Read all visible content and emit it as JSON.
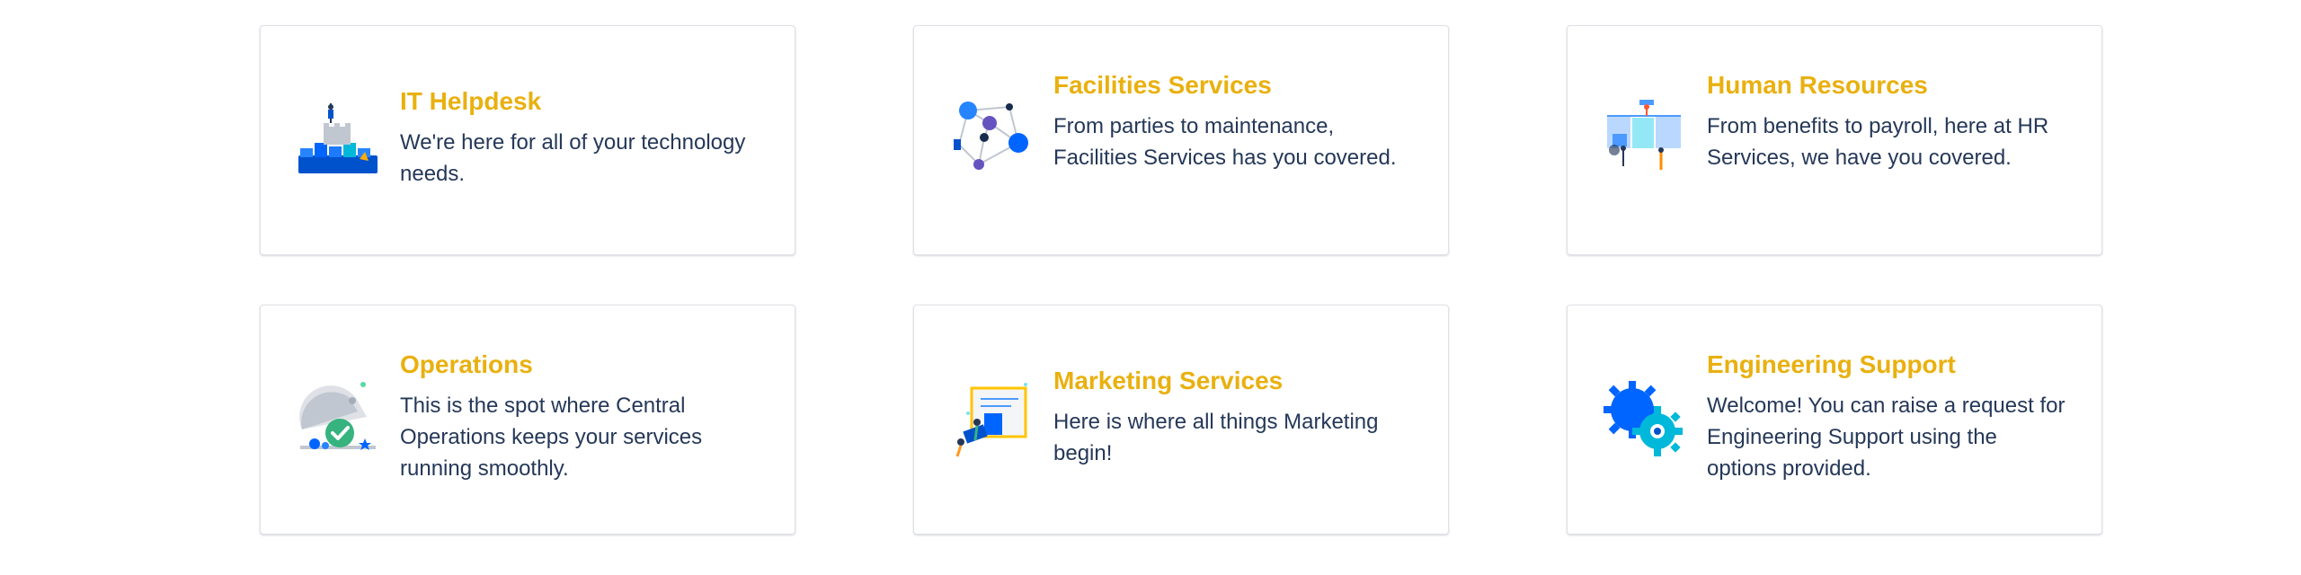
{
  "portals": [
    {
      "title": "IT Helpdesk",
      "description": "We're here for all of your technology needs.",
      "icon": "it-helpdesk-illustration-icon"
    },
    {
      "title": "Facilities Services",
      "description": "From parties to maintenance, Facilities Services has you covered.",
      "icon": "facilities-network-illustration-icon"
    },
    {
      "title": "Human Resources",
      "description": "From benefits to payroll, here at HR Services, we have you covered.",
      "icon": "human-resources-illustration-icon"
    },
    {
      "title": "Operations",
      "description": "This is the spot where Central Operations keeps your services running smoothly.",
      "icon": "operations-cloche-check-illustration-icon"
    },
    {
      "title": "Marketing Services",
      "description": "Here is where all things Marketing begin!",
      "icon": "marketing-board-illustration-icon"
    },
    {
      "title": "Engineering Support",
      "description": "Welcome! You can raise a request for Engineering Support using the options provided.",
      "icon": "engineering-gears-illustration-icon"
    }
  ],
  "colors": {
    "title": "#e9b00f",
    "text": "#253858",
    "border": "#dfe1e6"
  }
}
